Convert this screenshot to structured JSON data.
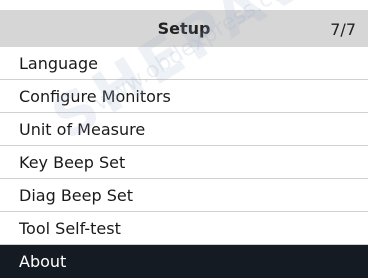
{
  "header": {
    "title": "Setup",
    "page_indicator": "7/7"
  },
  "menu": {
    "items": [
      {
        "label": "Language"
      },
      {
        "label": "Configure Monitors"
      },
      {
        "label": "Unit of Measure"
      },
      {
        "label": "Key Beep Set"
      },
      {
        "label": "Diag Beep Set"
      },
      {
        "label": "Tool Self-test"
      },
      {
        "label": "About",
        "selected": true
      }
    ]
  },
  "watermark": {
    "logo_text": "SHEPAVK",
    "url_text": "www.obdexpress.co.uk"
  },
  "colors": {
    "header_bg": "#d6d6d6",
    "selected_bg": "#151b22",
    "text": "#1a1a1a"
  }
}
